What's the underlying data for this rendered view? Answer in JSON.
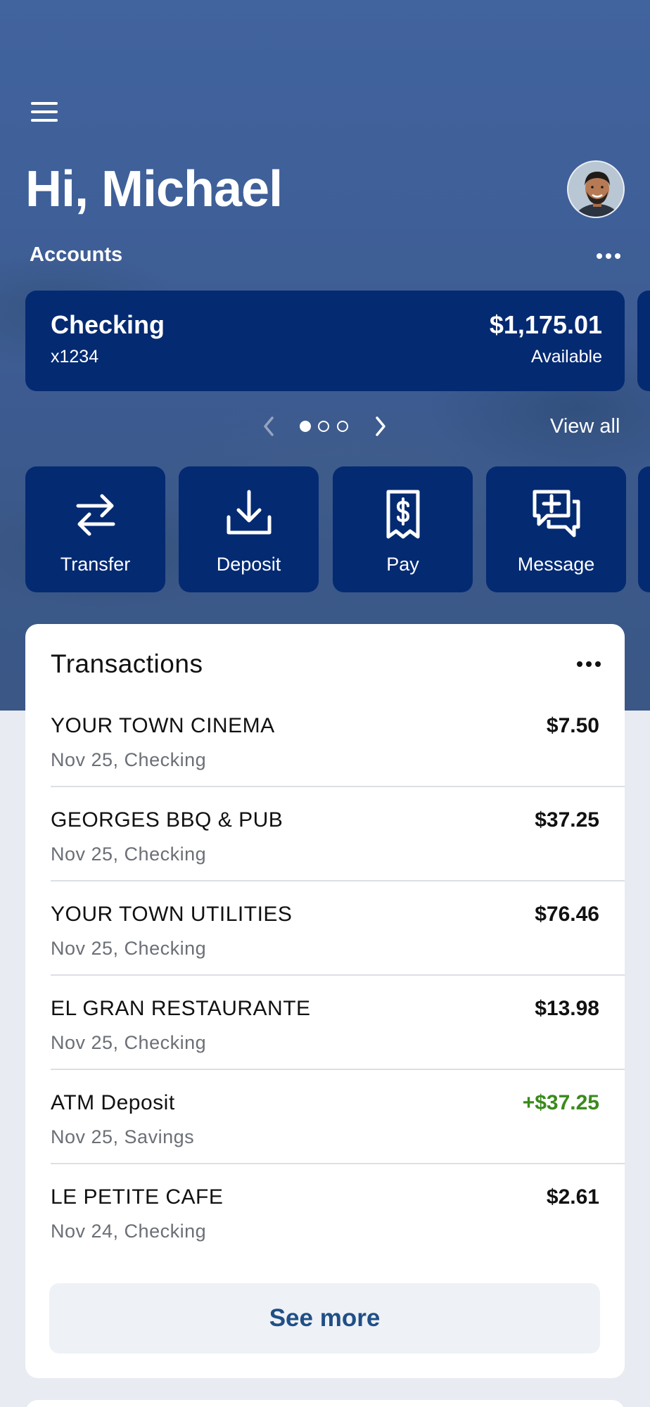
{
  "greeting": "Hi, Michael",
  "accounts_label": "Accounts",
  "account": {
    "name": "Checking",
    "number": "x1234",
    "balance": "$1,175.01",
    "balance_label": "Available"
  },
  "pager": {
    "total": 3,
    "active": 0,
    "view_all": "View all"
  },
  "actions": [
    {
      "label": "Transfer",
      "icon": "transfer-icon"
    },
    {
      "label": "Deposit",
      "icon": "deposit-icon"
    },
    {
      "label": "Pay",
      "icon": "pay-bill-icon"
    },
    {
      "label": "Message",
      "icon": "message-icon"
    }
  ],
  "transactions": {
    "title": "Transactions",
    "items": [
      {
        "merchant": "YOUR TOWN CINEMA",
        "meta": "Nov 25, Checking",
        "amount": "$7.50"
      },
      {
        "merchant": "GEORGES BBQ & PUB",
        "meta": "Nov 25, Checking",
        "amount": "$37.25"
      },
      {
        "merchant": "YOUR TOWN UTILITIES",
        "meta": "Nov 25, Checking",
        "amount": "$76.46"
      },
      {
        "merchant": "EL GRAN RESTAURANTE",
        "meta": "Nov 25, Checking",
        "amount": "$13.98"
      },
      {
        "merchant": "ATM Deposit",
        "meta": "Nov 25, Savings",
        "amount": "+$37.25"
      },
      {
        "merchant": "LE PETITE CAFE",
        "meta": "Nov 24, Checking",
        "amount": "$2.61"
      }
    ],
    "see_more": "See more"
  },
  "colors": {
    "brand_navy": "#042a72",
    "hero_blue": "#41639e",
    "credit_green": "#3a8a1c",
    "link_blue": "#1f4f86"
  }
}
